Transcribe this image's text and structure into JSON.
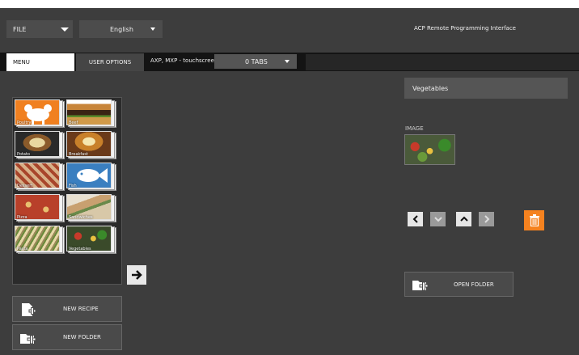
{
  "topbar": {
    "file_label": "FILE",
    "language": "English",
    "app_title": "ACP Remote Programming Interface"
  },
  "tabs": {
    "menu_label": "MENU",
    "user_options_label": "USER OPTIONS",
    "device_label": "AXP, MXP - touchscreen",
    "tabs_selector": "0 TABS"
  },
  "menu_grid": {
    "items": [
      {
        "label": "Poultry",
        "bg": "#f08020",
        "icon": "poultry-icon"
      },
      {
        "label": "Beef",
        "bg": "#6b4a2a",
        "icon": "beef-photo"
      },
      {
        "label": "Potato",
        "bg": "#8a6a3a",
        "icon": "potato-photo"
      },
      {
        "label": "Breakfast",
        "bg": "#b4773d",
        "icon": "breakfast-photo"
      },
      {
        "label": "Dessert",
        "bg": "#a8553b",
        "icon": "dessert-photo"
      },
      {
        "label": "Fish",
        "bg": "#3a7fc0",
        "icon": "fish-icon"
      },
      {
        "label": "Pizza",
        "bg": "#b8402a",
        "icon": "pizza-photo"
      },
      {
        "label": "Sandwiches",
        "bg": "#c8b89a",
        "icon": "sandwich-photo"
      },
      {
        "label": "Pasta",
        "bg": "#b8a07a",
        "icon": "pasta-photo"
      },
      {
        "label": "Vegetables",
        "bg": "#4a6a2a",
        "icon": "vegetables-photo"
      }
    ]
  },
  "buttons": {
    "new_recipe": "NEW RECIPE",
    "new_folder": "NEW FOLDER",
    "open_folder": "OPEN FOLDER"
  },
  "detail": {
    "folder_name": "Vegetables",
    "image_label": "IMAGE"
  },
  "colors": {
    "background": "#3d3d3d",
    "accent_orange": "#f5821f",
    "fish_blue": "#3a7fc0"
  }
}
